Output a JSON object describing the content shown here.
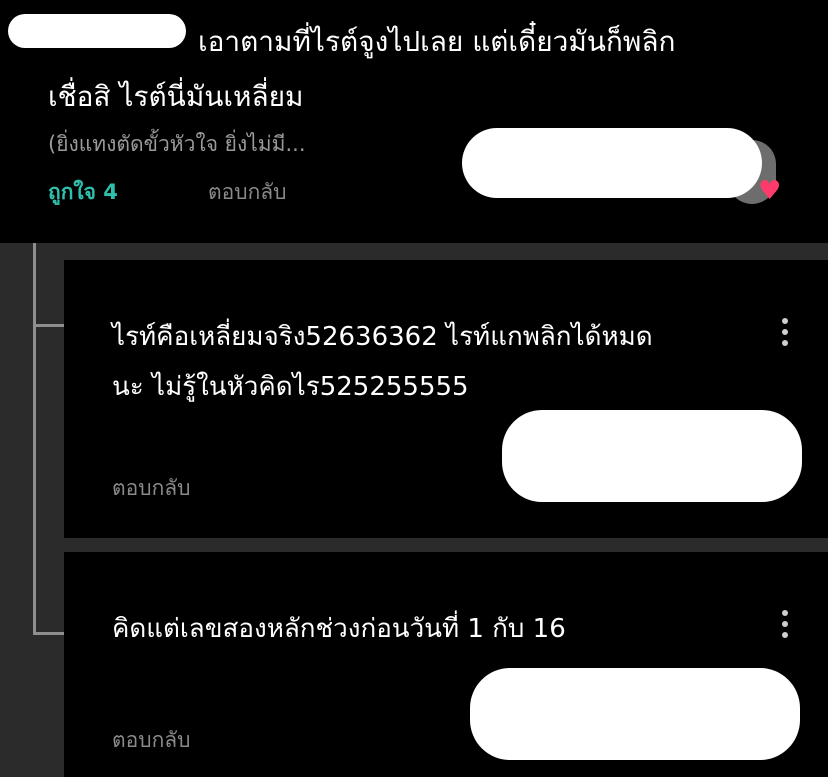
{
  "parent_comment": {
    "text_line1": "เอาตามที่ไรต์จูงไปเลย แต่เดี๋ยวมันก็พลิก",
    "text_line2": "เชื่อสิ ไรต์นี่มันเหลี่ยม",
    "quoted_preview": "(ยิ่งแทงตัดขั้วหัวใจ ยิ่งไม่มี...",
    "like_label": "ถูกใจ 4",
    "reply_label": "ตอบกลับ",
    "like_icon": "heart-icon"
  },
  "replies": [
    {
      "text_line1": "ไรท์คือเหลี่ยมจริง52636362 ไรท์แกพลิกได้หมด",
      "text_line2": "นะ ไม่รู้ในหัวคิดไร525255555",
      "reply_label": "ตอบกลับ"
    },
    {
      "text_line1": "คิดแต่เลขสองหลักช่วงก่อนวันที่ 1 กับ 16",
      "reply_label": "ตอบกลับ"
    }
  ],
  "colors": {
    "background": "#000000",
    "thread_gap": "#2b2b2b",
    "like_accent": "#2fc0ad",
    "muted_text": "#8a8a8a",
    "heart": "#ff3b6b"
  }
}
